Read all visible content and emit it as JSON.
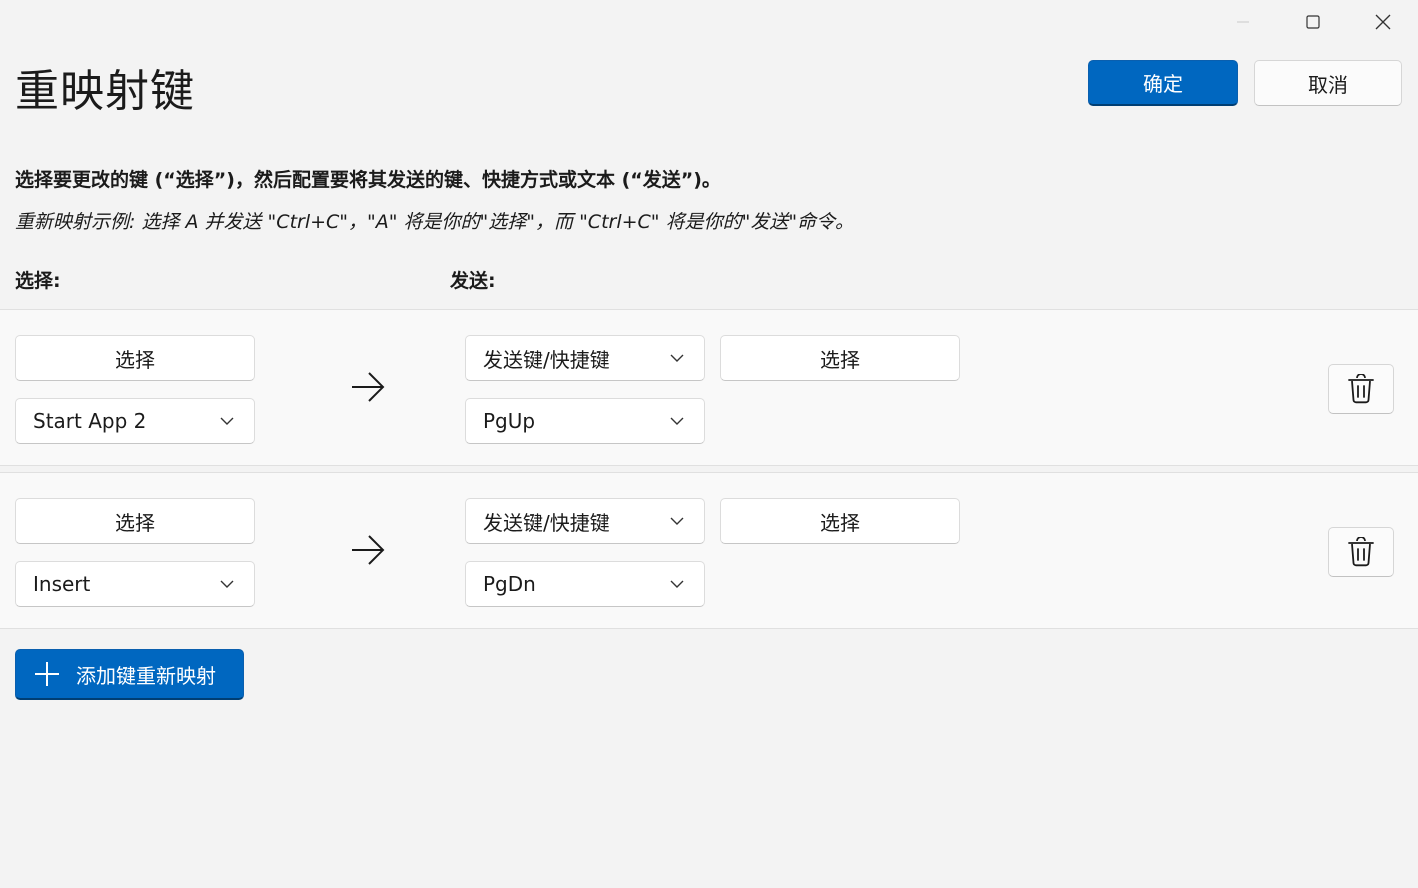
{
  "window": {
    "controls": {
      "minimize": "minimize-icon",
      "maximize": "maximize-icon",
      "close": "close-icon"
    }
  },
  "header": {
    "title": "重映射键",
    "ok_label": "确定",
    "cancel_label": "取消"
  },
  "instructions": {
    "main": "选择要更改的键 (“选择”)，然后配置要将其发送的键、快捷方式或文本 (“发送”)。",
    "example": "重新映射示例: 选择 A 并发送 \"Ctrl+C\"，\"A\" 将是你的\"选择\"，而 \"Ctrl+C\" 将是你的\"发送\"命令。"
  },
  "columns": {
    "select": "选择:",
    "send": "发送:"
  },
  "rows": [
    {
      "select_button": "选择",
      "select_value": "Start App 2",
      "send_type": "发送键/快捷键",
      "send_select_button": "选择",
      "send_value": "PgUp"
    },
    {
      "select_button": "选择",
      "select_value": "Insert",
      "send_type": "发送键/快捷键",
      "send_select_button": "选择",
      "send_value": "PgDn"
    }
  ],
  "footer": {
    "add_label": "添加键重新映射"
  },
  "colors": {
    "accent": "#0067c0",
    "background": "#f3f3f3",
    "row_background": "#f9f9f9"
  }
}
